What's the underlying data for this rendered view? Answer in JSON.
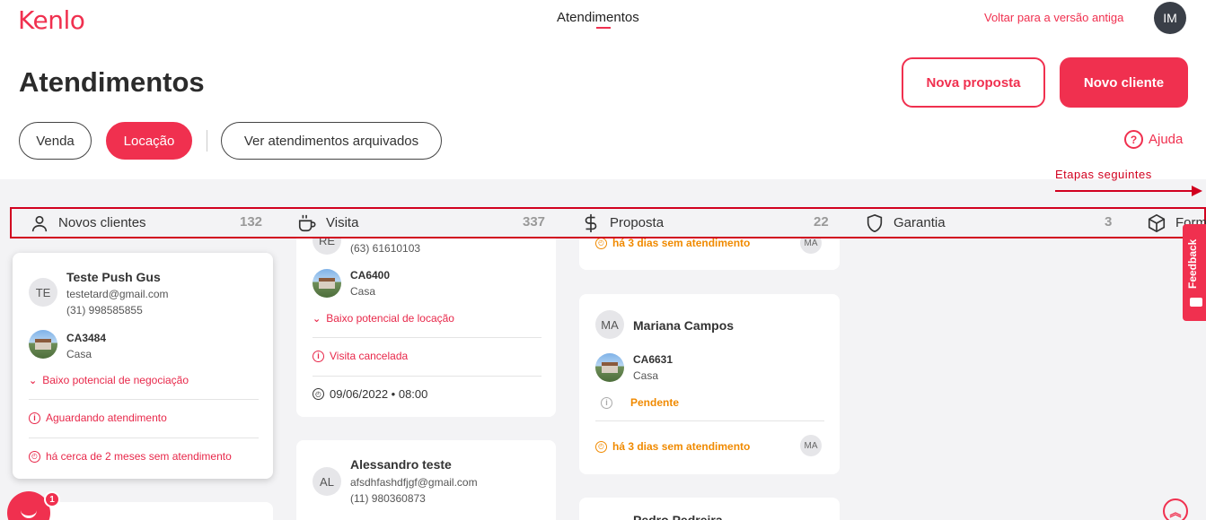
{
  "header": {
    "logo": "Kenlo",
    "nav_active": "Atendimentos",
    "old_version_link": "Voltar para a versão antiga",
    "user_initials": "IM"
  },
  "page": {
    "title": "Atendimentos",
    "btn_nova_proposta": "Nova proposta",
    "btn_novo_cliente": "Novo cliente",
    "filters": [
      "Venda",
      "Locação",
      "Ver atendimentos arquivados"
    ],
    "active_filter": "Locação",
    "help": "Ajuda",
    "next_steps": "Etapas seguintes"
  },
  "columns": [
    {
      "label": "Novos clientes",
      "count": "132",
      "icon": "user-icon"
    },
    {
      "label": "Visita",
      "count": "337",
      "icon": "coffee-icon"
    },
    {
      "label": "Proposta",
      "count": "22",
      "icon": "dollar-icon"
    },
    {
      "label": "Garantia",
      "count": "3",
      "icon": "shield-icon"
    },
    {
      "label": "Form",
      "count": "",
      "icon": "box-icon"
    }
  ],
  "cards": {
    "c1": {
      "initials": "TE",
      "name": "Teste Push Gus",
      "email": "testetard@gmail.com",
      "phone": "(31) 998585855",
      "code": "CA3484",
      "type": "Casa",
      "potential": "Baixo potencial de negociação",
      "status": "Aguardando atendimento",
      "time": "há cerca de 2 meses sem atendimento"
    },
    "c2": {
      "initials": "RE",
      "phone": "(63) 61610103",
      "code": "CA6400",
      "type": "Casa",
      "potential": "Baixo potencial de locação",
      "status": "Visita cancelada",
      "date": "09/06/2022 • 08:00"
    },
    "c3": {
      "initials": "AL",
      "name": "Alessandro teste",
      "email": "afsdhfashdfjgf@gmail.com",
      "phone": "(11) 980360873"
    },
    "c4": {
      "time": "há 3 dias sem atendimento",
      "agent": "MA"
    },
    "c5": {
      "initials": "MA",
      "name": "Mariana Campos",
      "code": "CA6631",
      "type": "Casa",
      "status": "Pendente",
      "time": "há 3 dias sem atendimento",
      "agent": "MA"
    },
    "c6": {
      "name": "Pedro Pedreira"
    }
  },
  "feedback": "Feedback",
  "chat_badge": "1"
}
